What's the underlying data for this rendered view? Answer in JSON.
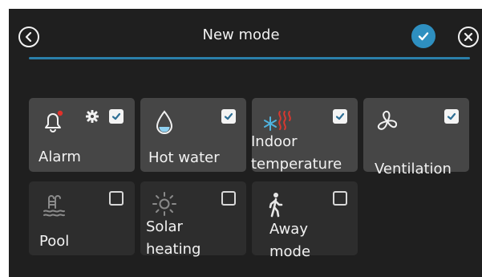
{
  "header": {
    "title": "New mode",
    "back_icon": "chevron-left-circle-icon",
    "confirm_icon": "check-circle-icon",
    "close_icon": "close-circle-icon"
  },
  "colors": {
    "background": "#1f1f1f",
    "tile_active": "#464646",
    "tile_inactive": "#2d2d2d",
    "accent": "#2e8fc0",
    "alarm_dot": "#e0312a",
    "water": "#8fd0f0",
    "heat": "#d9382f",
    "cold": "#4fb3e0"
  },
  "tiles": [
    {
      "label": "Alarm",
      "icon": "bell-icon",
      "checked": true,
      "has_settings": true
    },
    {
      "label": "Hot water",
      "icon": "water-drop-icon",
      "checked": true
    },
    {
      "label": "Indoor\ntemperature",
      "icon": "heat-cool-icon",
      "checked": true
    },
    {
      "label": "Ventilation",
      "icon": "fan-icon",
      "checked": true
    },
    {
      "label": "Pool",
      "icon": "pool-icon",
      "checked": false
    },
    {
      "label": "Solar\nheating",
      "icon": "sun-icon",
      "checked": false
    },
    {
      "label": "Away\nmode",
      "icon": "walking-person-icon",
      "checked": false
    }
  ]
}
